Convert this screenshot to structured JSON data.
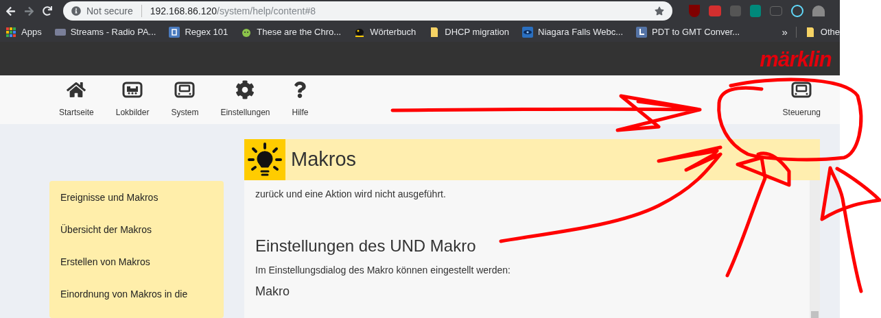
{
  "browser": {
    "security": "Not secure",
    "url_host": "192.168.86.120",
    "url_path": "/system/help/content#8",
    "bookmarks": [
      {
        "label": "Apps",
        "kind": "apps"
      },
      {
        "label": "Streams - Radio PA...",
        "kind": "rp"
      },
      {
        "label": "Regex 101",
        "kind": "r"
      },
      {
        "label": "These are the Chro...",
        "kind": "android"
      },
      {
        "label": "Wörterbuch",
        "kind": "bird"
      },
      {
        "label": "DHCP migration",
        "kind": "folder"
      },
      {
        "label": "Niagara Falls Webc...",
        "kind": "eye"
      },
      {
        "label": "PDT to GMT Conver...",
        "kind": "clock"
      }
    ],
    "more": "»",
    "other": "Othe"
  },
  "logo": "märklin",
  "nav": [
    {
      "label": "Startseite",
      "kind": "home"
    },
    {
      "label": "Lokbilder",
      "kind": "train"
    },
    {
      "label": "System",
      "kind": "device"
    },
    {
      "label": "Einstellungen",
      "kind": "gear"
    },
    {
      "label": "Hilfe",
      "kind": "help"
    }
  ],
  "nav_right": {
    "label": "Steuerung",
    "kind": "device"
  },
  "sidebar": {
    "items": [
      "Ereignisse und Makros",
      "Übersicht der Makros",
      "Erstellen von Makros",
      "Einordnung von Makros in die"
    ]
  },
  "content": {
    "title": "Makros",
    "paragraph": "zurück und eine Aktion wird nicht ausgeführt.",
    "heading": "Einstellungen des UND Makro",
    "intro": "Im Einstellungsdialog des Makro können eingestellt werden:",
    "subheading": "Makro"
  }
}
